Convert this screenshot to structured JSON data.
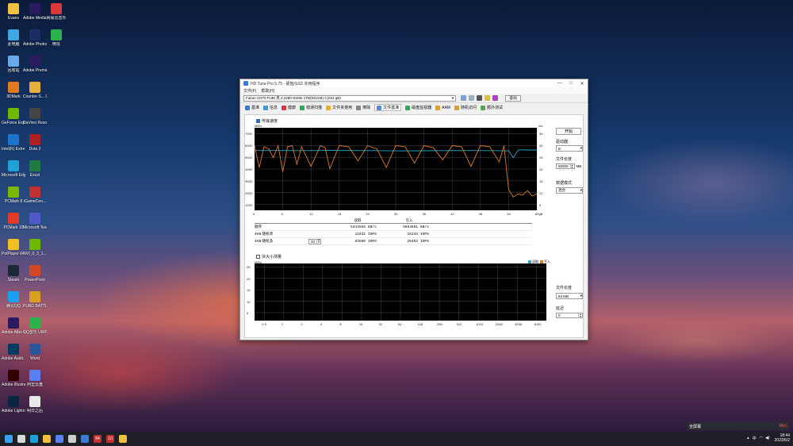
{
  "desktop": {
    "icons": [
      {
        "label": "Evans",
        "color": "#f0c040",
        "x": 2,
        "y": 4
      },
      {
        "label": "Adobe Media...",
        "color": "#2a1b5e",
        "x": 29,
        "y": 4
      },
      {
        "label": "网易云音乐",
        "color": "#d83a3a",
        "x": 56,
        "y": 4
      },
      {
        "label": "此电脑",
        "color": "#3fa6e0",
        "x": 2,
        "y": 37
      },
      {
        "label": "Adobe Photosh...",
        "color": "#1a2e66",
        "x": 29,
        "y": 37
      },
      {
        "label": "微信",
        "color": "#2bb24c",
        "x": 56,
        "y": 37
      },
      {
        "label": "回收站",
        "color": "#6aa8e8",
        "x": 2,
        "y": 70
      },
      {
        "label": "Adobe Premie...",
        "color": "#2a1b5e",
        "x": 29,
        "y": 70
      },
      {
        "label": "3DMark",
        "color": "#e07a20",
        "x": 2,
        "y": 103
      },
      {
        "label": "Counter-S... Global Off...",
        "color": "#e8b040",
        "x": 29,
        "y": 103
      },
      {
        "label": "GeForce Experience",
        "color": "#6fb800",
        "x": 2,
        "y": 136
      },
      {
        "label": "DaVinci Resolve",
        "color": "#444",
        "x": 29,
        "y": 136
      },
      {
        "label": "Intel(R) Extre...",
        "color": "#1d73c9",
        "x": 2,
        "y": 169
      },
      {
        "label": "Dota 2",
        "color": "#b02020",
        "x": 29,
        "y": 169
      },
      {
        "label": "Microsoft Edge",
        "color": "#1fa0d8",
        "x": 2,
        "y": 202
      },
      {
        "label": "Excel",
        "color": "#1d7a45",
        "x": 29,
        "y": 202
      },
      {
        "label": "PCMark 8",
        "color": "#7ab800",
        "x": 2,
        "y": 235
      },
      {
        "label": "iGameCen...",
        "color": "#c03030",
        "x": 29,
        "y": 235
      },
      {
        "label": "PCMark 10",
        "color": "#e03a2a",
        "x": 2,
        "y": 268
      },
      {
        "label": "Microsoft Teams",
        "color": "#5059c9",
        "x": 29,
        "y": 268
      },
      {
        "label": "PotPlayer 64 bit",
        "color": "#f0c020",
        "x": 2,
        "y": 301
      },
      {
        "label": "NVI_0_3_1...",
        "color": "#6fb800",
        "x": 29,
        "y": 301
      },
      {
        "label": "Steam",
        "color": "#1b2838",
        "x": 2,
        "y": 334
      },
      {
        "label": "PowerPoint",
        "color": "#d24726",
        "x": 29,
        "y": 334
      },
      {
        "label": "腾讯QQ",
        "color": "#1aa0f0",
        "x": 2,
        "y": 367
      },
      {
        "label": "PUBG BATTLEGR...",
        "color": "#d8a020",
        "x": 29,
        "y": 367
      },
      {
        "label": "Adobe After Effects 2022",
        "color": "#2a1b5e",
        "x": 2,
        "y": 400
      },
      {
        "label": "QQ音乐 UWP",
        "color": "#2bb24c",
        "x": 29,
        "y": 400
      },
      {
        "label": "Adobe Audit...",
        "color": "#003a5e",
        "x": 2,
        "y": 433
      },
      {
        "label": "Word",
        "color": "#2b579a",
        "x": 29,
        "y": 433
      },
      {
        "label": "Adobe Illustrat...",
        "color": "#330000",
        "x": 2,
        "y": 466
      },
      {
        "label": "阿里云盘",
        "color": "#5a7ff0",
        "x": 29,
        "y": 466
      },
      {
        "label": "Adobe Lightroo...",
        "color": "#0a2640",
        "x": 2,
        "y": 499
      },
      {
        "label": "明日之后",
        "color": "#e8e8e8",
        "x": 29,
        "y": 499
      }
    ]
  },
  "window": {
    "title": "HD Tune Pro 5.75 - 硬盘/SSD 实用程序",
    "minimize": "—",
    "maximize": "□",
    "close": "✕",
    "menu": [
      "文件(F)",
      "帮助(H)"
    ],
    "drive": "Fubon CN70 FUBI 黑 2 2280 NVMe 1TB(931GB)  C(024 gB)",
    "exit_label": "退出",
    "tabs": [
      {
        "label": "基准",
        "color": "#3a7bd5"
      },
      {
        "label": "信息",
        "color": "#3a9bd5"
      },
      {
        "label": "健康",
        "color": "#d53a3a"
      },
      {
        "label": "错误扫描",
        "color": "#3aa55a"
      },
      {
        "label": "文件夹使用",
        "color": "#e0b030"
      },
      {
        "label": "擦除",
        "color": "#888888"
      },
      {
        "label": "文件基准",
        "color": "#5a8ad5",
        "active": true
      },
      {
        "label": "磁盘监视器",
        "color": "#3aa55a"
      },
      {
        "label": "AAM",
        "color": "#e0a030"
      },
      {
        "label": "随机访问",
        "color": "#d5a03a"
      },
      {
        "label": "额外测试",
        "color": "#5aa05a"
      }
    ]
  },
  "file_benchmark": {
    "transfer_checkbox": "传输速度",
    "block_checkbox": "块大小测量",
    "start_button": "开始",
    "drive_letter_label": "驱动器",
    "drive_letter_value": "E:",
    "file_length_label": "文件长度",
    "file_length_value": "60000",
    "file_length_unit": "MB",
    "data_mode_label": "数据模式",
    "data_mode_value": "混合",
    "block_file_length_label": "文件长度",
    "block_file_length_value": "64 MB",
    "delay_label": "延迟",
    "delay_value": "0",
    "queue_depth": "32",
    "results_header": {
      "read": "读取",
      "write": "写入"
    },
    "results": [
      {
        "label": "顺序",
        "read_val": "5443558",
        "read_unit": "KB/s",
        "write_val": "5694891",
        "write_unit": "KB/s"
      },
      {
        "label": "4KB 随机单",
        "read_val": "11632",
        "read_unit": "IOPS",
        "write_val": "15233",
        "write_unit": "IOPS"
      },
      {
        "label": "4KB 随机多",
        "read_val": "83580",
        "read_unit": "IOPS",
        "write_val": "29453",
        "write_unit": "IOPS"
      }
    ],
    "legend": [
      "读取",
      "写入"
    ]
  },
  "chart_data": [
    {
      "type": "line",
      "ylabel": "MB/s",
      "ylabel_right": "ms",
      "y_ticks": [
        "7000",
        "6000",
        "5000",
        "4000",
        "3000",
        "2000",
        "1000"
      ],
      "y_ticks_right": [
        "35",
        "30",
        "25",
        "20",
        "15",
        "10",
        "5"
      ],
      "x_ticks": [
        "0",
        "6",
        "12",
        "18",
        "24",
        "30",
        "36",
        "42",
        "48",
        "54",
        "60gB"
      ],
      "xlim": [
        0,
        60
      ],
      "ylim": [
        0,
        7000
      ],
      "series": [
        {
          "name": "读取",
          "color": "#2aa8c8",
          "x": [
            0,
            5,
            10,
            15,
            20,
            25,
            30,
            35,
            40,
            45,
            50,
            54,
            55,
            56,
            57,
            58,
            59,
            60
          ],
          "y": [
            5450,
            5450,
            5440,
            5460,
            5450,
            5440,
            5420,
            5430,
            5440,
            5450,
            5440,
            5430,
            4800,
            5500,
            5520,
            5500,
            5510,
            5500
          ]
        },
        {
          "name": "写入",
          "color": "#e07a20",
          "x": [
            0,
            1,
            2,
            3,
            4,
            5,
            6,
            7,
            8,
            9,
            10,
            12,
            14,
            15,
            16,
            18,
            20,
            22,
            24,
            26,
            28,
            30,
            32,
            34,
            36,
            38,
            40,
            42,
            44,
            46,
            48,
            50,
            52,
            53,
            54,
            55,
            56,
            57,
            58,
            59,
            60
          ],
          "y": [
            5900,
            3900,
            5800,
            5600,
            4800,
            5900,
            3500,
            5800,
            5900,
            4200,
            5800,
            4000,
            5900,
            5700,
            3800,
            5900,
            5800,
            4500,
            5900,
            5600,
            3900,
            5900,
            5800,
            4300,
            5900,
            5700,
            4600,
            5900,
            5800,
            4000,
            5900,
            5800,
            4400,
            5900,
            1900,
            1200,
            1500,
            1400,
            1800,
            1300,
            1500
          ]
        }
      ]
    },
    {
      "type": "bar",
      "ylabel": "MB/s",
      "y_ticks": [
        "25",
        "20",
        "15",
        "10",
        "5"
      ],
      "ylim": [
        0,
        25
      ],
      "categories": [
        "0.5",
        "1",
        "2",
        "4",
        "8",
        "16",
        "32",
        "64",
        "128",
        "256",
        "512",
        "1024",
        "2048",
        "4096",
        "8192"
      ],
      "series": [
        {
          "name": "读取",
          "color": "#2aa8c8",
          "values": []
        },
        {
          "name": "写入",
          "color": "#e07a20",
          "values": []
        }
      ]
    }
  ],
  "taskbar": {
    "icons": [
      {
        "name": "start-icon",
        "color": "#3aa0f0"
      },
      {
        "name": "search-icon",
        "color": "#d8d8d8"
      },
      {
        "name": "edge-icon",
        "color": "#1fa0d8"
      },
      {
        "name": "explorer-icon",
        "color": "#f0c040"
      },
      {
        "name": "store-icon",
        "color": "#5a7ff0"
      },
      {
        "name": "settings-icon",
        "color": "#cccccc"
      },
      {
        "name": "hdtune-icon",
        "color": "#3a7bd5"
      },
      {
        "name": "cpuz-icon",
        "color": "#c03030"
      },
      {
        "name": "app10-icon",
        "color": "#c03030"
      },
      {
        "name": "paint-icon",
        "color": "#f0c040"
      }
    ],
    "icon_texts": {
      "cpuz": "64",
      "app10": "10"
    },
    "clock_time": "18:44",
    "clock_date": "2023/6/2",
    "lang": "中",
    "obs": {
      "label": "全屏幕",
      "rec": "REC"
    }
  }
}
